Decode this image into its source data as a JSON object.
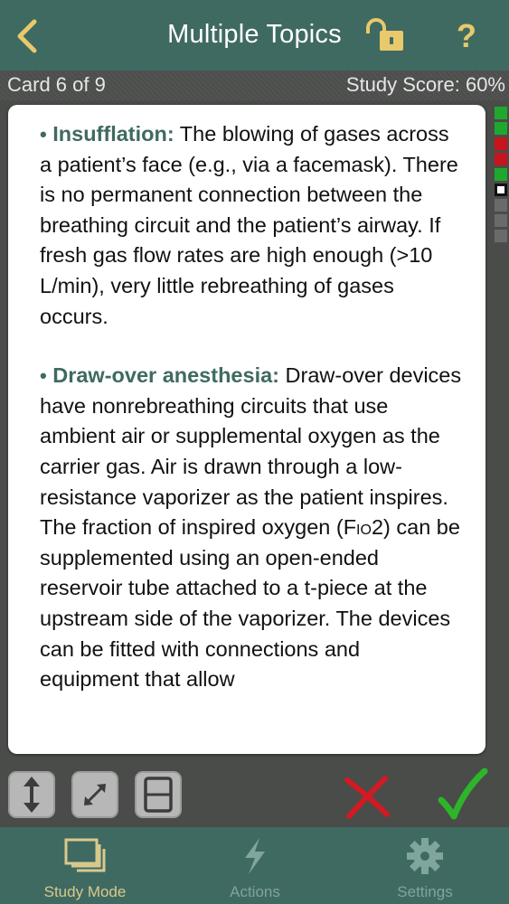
{
  "header": {
    "title": "Multiple Topics",
    "back_icon": "chevron-left-icon",
    "lock_icon": "unlock-icon",
    "help_label": "?"
  },
  "status": {
    "card_counter": "Card 6 of 9",
    "study_score": "Study Score: 60%"
  },
  "card": {
    "paragraphs": [
      {
        "bullet": "•",
        "term": "Insufflation:",
        "text": " The blowing of gases across a patient’s face (e.g., via a facemask). There is no permanent connection between the breathing circuit and the patient’s airway. If fresh gas flow rates are high enough (>10 L/min), very little rebreathing of gases occurs."
      },
      {
        "bullet": "•",
        "term": "Draw-over anesthesia:",
        "text_a": " Draw-over devices have nonrebreathing circuits that use ambient air or supplemental oxygen as the carrier gas. Air is drawn through a low-resistance vaporizer as the patient inspires. The fraction of inspired oxygen (",
        "text_sc": "Fio2",
        "text_b": ") can be supplemented using an open-ended reservoir tube attached to a t-piece at the upstream side of the vaporizer. The devices can be fitted with connections and equipment that allow"
      }
    ]
  },
  "progress_markers": [
    "correct",
    "correct",
    "incorrect",
    "incorrect",
    "correct",
    "current",
    "unanswered",
    "unanswered",
    "unanswered"
  ],
  "colors": {
    "header": "#3f6a62",
    "accent_text": "#3f6a62",
    "correct": "#1fa82e",
    "incorrect": "#c8141c",
    "unanswered": "#6a6a6a",
    "help": "#e8c96b",
    "active_tab": "#d9c88c"
  },
  "controls": {
    "flip_icon": "vertical-arrows-icon",
    "expand_icon": "expand-arrows-icon",
    "layout_icon": "split-card-icon",
    "wrong_icon": "red-x-icon",
    "right_icon": "green-check-icon"
  },
  "tabs": [
    {
      "label": "Study Mode",
      "icon": "stacked-cards-icon",
      "active": true
    },
    {
      "label": "Actions",
      "icon": "lightning-icon",
      "active": false
    },
    {
      "label": "Settings",
      "icon": "gear-icon",
      "active": false
    }
  ]
}
